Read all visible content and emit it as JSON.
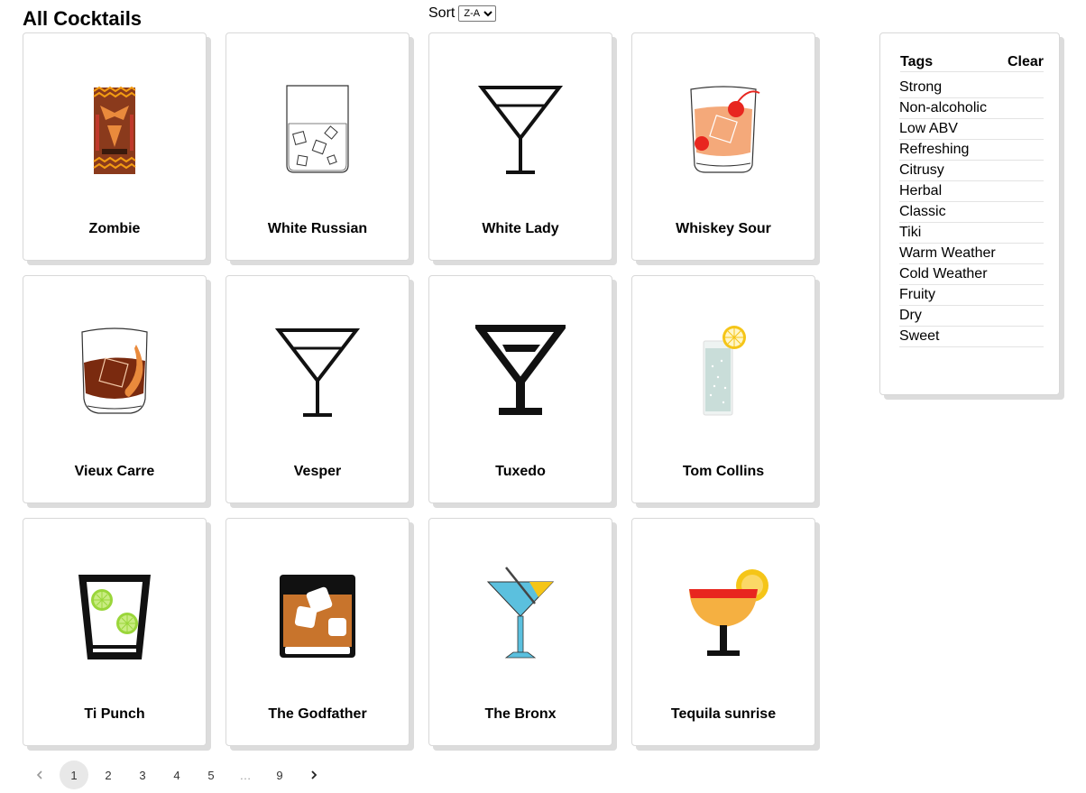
{
  "header": {
    "title": "All Cocktails"
  },
  "sort": {
    "label": "Sort",
    "selected": "Z-A",
    "options": [
      "Z-A"
    ]
  },
  "cocktails": [
    {
      "name": "Zombie",
      "icon": "tiki-mask-icon"
    },
    {
      "name": "White Russian",
      "icon": "rocks-glass-ice-icon"
    },
    {
      "name": "White Lady",
      "icon": "martini-glass-icon"
    },
    {
      "name": "Whiskey Sour",
      "icon": "whiskey-sour-glass-icon"
    },
    {
      "name": "Vieux Carre",
      "icon": "rocks-glass-orange-peel-icon"
    },
    {
      "name": "Vesper",
      "icon": "martini-glass-icon"
    },
    {
      "name": "Tuxedo",
      "icon": "bold-martini-glass-icon"
    },
    {
      "name": "Tom Collins",
      "icon": "highball-lemon-icon"
    },
    {
      "name": "Ti Punch",
      "icon": "lime-glass-icon"
    },
    {
      "name": "The Godfather",
      "icon": "rocks-glass-amber-icon"
    },
    {
      "name": "The Bronx",
      "icon": "blue-martini-straw-icon"
    },
    {
      "name": "Tequila sunrise",
      "icon": "sunrise-coupe-icon"
    }
  ],
  "tags": {
    "title": "Tags",
    "clear_label": "Clear",
    "items": [
      "Strong",
      "Non-alcoholic",
      "Low ABV",
      "Refreshing",
      "Citrusy",
      "Herbal",
      "Classic",
      "Tiki",
      "Warm Weather",
      "Cold Weather",
      "Fruity",
      "Dry",
      "Sweet"
    ]
  },
  "pagination": {
    "prev_icon": "chevron-left-icon",
    "next_icon": "chevron-right-icon",
    "pages": [
      "1",
      "2",
      "3",
      "4",
      "5",
      "…",
      "9"
    ],
    "current": "1"
  },
  "colors": {
    "card_shadow": "#dcdcdc",
    "orange": "#e98a3c",
    "tiki_brown": "#8a3a1c",
    "lime": "#9ad63a",
    "lemon": "#f5c518",
    "blue_drink": "#5bc0de",
    "sunrise_red": "#e8261f"
  }
}
